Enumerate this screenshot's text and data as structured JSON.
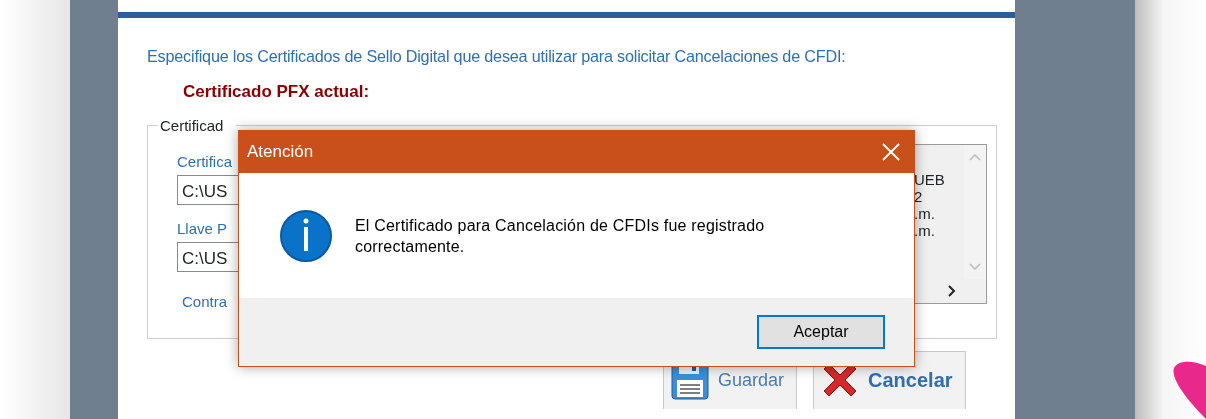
{
  "form": {
    "instruction": "Especifique los Certificados de Sello Digital que desea utilizar para solicitar Cancelaciones de CFDI:",
    "current_label": "Certificado PFX actual:"
  },
  "group": {
    "legend": "Certificad",
    "fields": [
      {
        "label": "Certifica",
        "value": "C:\\US"
      },
      {
        "label": "Llave P",
        "value": "C:\\US"
      }
    ],
    "password_label": "Contra",
    "details": [
      "UEB",
      "2",
      ".m.",
      ".m."
    ]
  },
  "buttons": [
    {
      "label": "Guardar",
      "kind": "save"
    },
    {
      "label": "Cancelar",
      "kind": "cancel"
    }
  ],
  "dialog": {
    "title": "Atención",
    "message": "El Certificado para Cancelación de CFDIs fue registrado correctamente.",
    "button": "Aceptar"
  }
}
